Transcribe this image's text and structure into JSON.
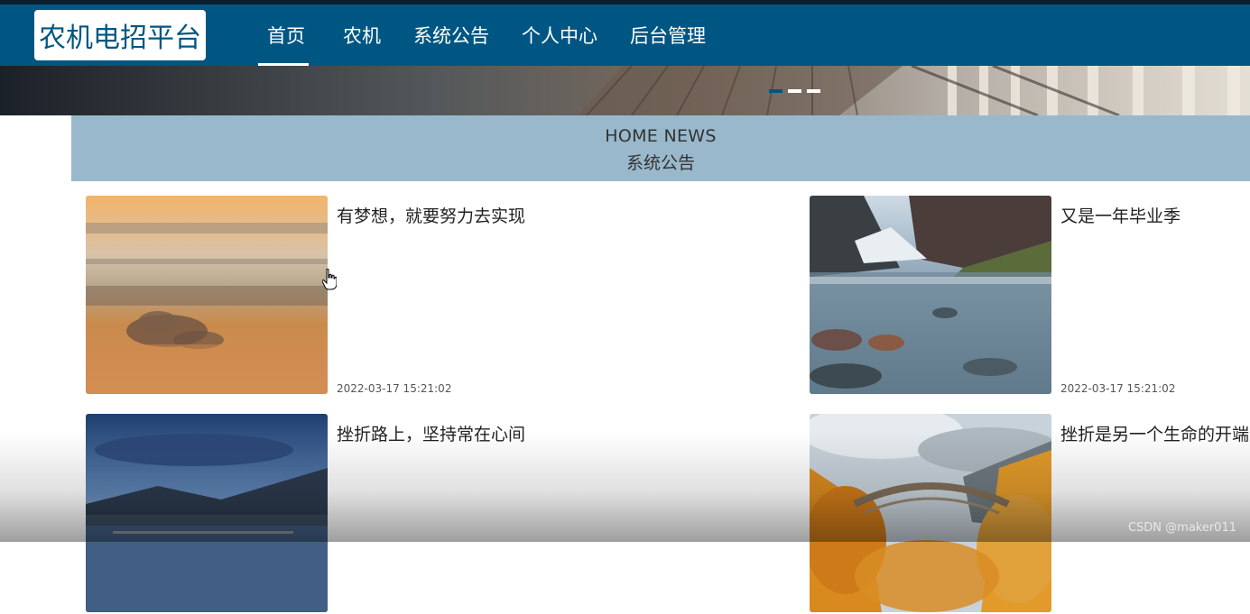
{
  "header": {
    "logo": "农机电招平台",
    "nav": [
      {
        "label": "首页",
        "active": true
      },
      {
        "label": "农机"
      },
      {
        "label": "系统公告"
      },
      {
        "label": "个人中心"
      },
      {
        "label": "后台管理"
      }
    ],
    "bg_color": "#005682"
  },
  "banner": {
    "dots": 3,
    "active_dot": 0
  },
  "news": {
    "title_en": "HOME NEWS",
    "title_zh": "系统公告",
    "items": [
      {
        "title": "有梦想，就要努力去实现",
        "date": "2022-03-17 15:21:02",
        "image": "sunset-clouds"
      },
      {
        "title": "又是一年毕业季",
        "date": "2022-03-17 15:21:02",
        "image": "mountain-river"
      },
      {
        "title": "挫折路上，坚持常在心间",
        "date": "",
        "image": "lake-town-dusk"
      },
      {
        "title": "挫折是另一个生命的开端",
        "date": "",
        "image": "stone-bridge-autumn"
      }
    ]
  },
  "watermark": "CSDN @maker011"
}
